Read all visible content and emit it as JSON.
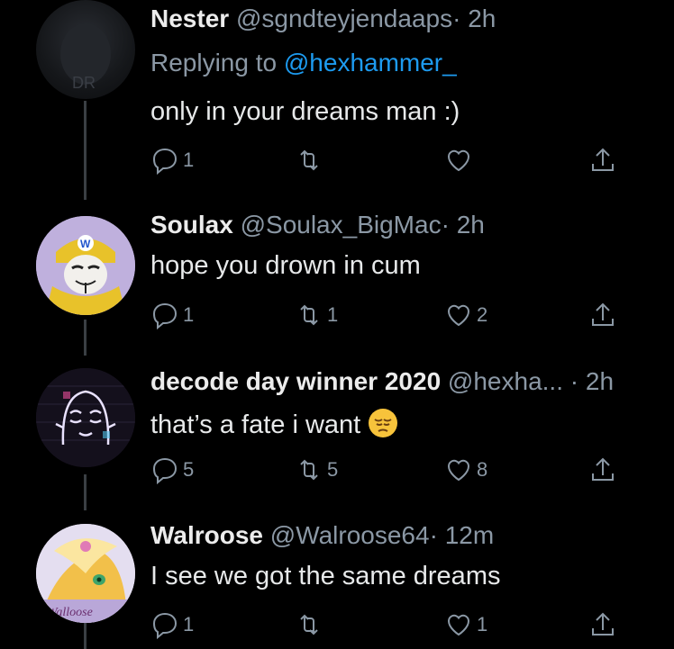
{
  "colors": {
    "background": "#000000",
    "link": "#1d9bf0",
    "muted": "#8b98a5",
    "line": "#3a3f44"
  },
  "tweets": [
    {
      "name": "Nester",
      "handle": "@sgndteyjendaaps",
      "dot": "·",
      "time": "2h",
      "replying_prefix": "Replying to",
      "replying_to": "@hexhammer_",
      "text": "only in your dreams man :)",
      "reply_count": "1",
      "retweet_count": "",
      "like_count": ""
    },
    {
      "name": "Soulax",
      "handle": "@Soulax_BigMac",
      "dot": "·",
      "time": "2h",
      "text": "hope you drown in cum",
      "reply_count": "1",
      "retweet_count": "1",
      "like_count": "2"
    },
    {
      "name": "decode day winner 2020",
      "handle": "@hexha...",
      "dot": "·",
      "time": "2h",
      "text": "that’s a fate i want",
      "emoji": "pensive-face",
      "reply_count": "5",
      "retweet_count": "5",
      "like_count": "8"
    },
    {
      "name": "Walroose",
      "handle": "@Walroose64",
      "dot": "·",
      "time": "12m",
      "text": "I see we got the same dreams",
      "avatar_signature": "Walloose",
      "reply_count": "1",
      "retweet_count": "",
      "like_count": "1"
    }
  ]
}
